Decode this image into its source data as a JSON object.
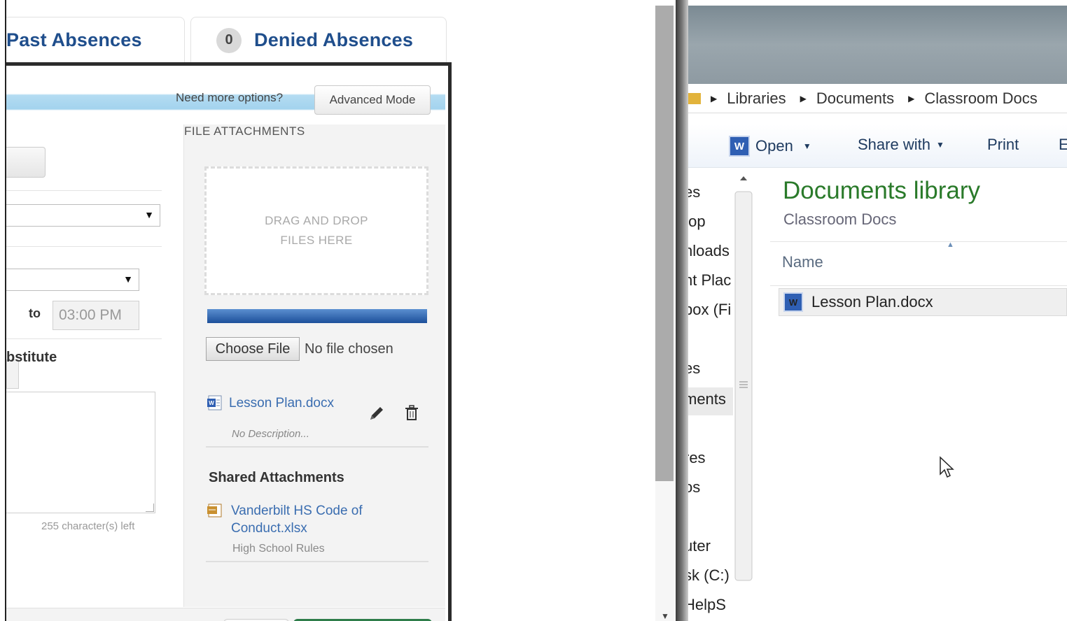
{
  "tabs": {
    "past": "Past Absences",
    "denied": "Denied Absences",
    "denied_count": "0"
  },
  "dialog": {
    "need_more": "Need more options?",
    "advanced_mode": "Advanced Mode",
    "to_label": "to",
    "end_time": "03:00 PM",
    "substitute_label": "bstitute",
    "chars_left": "255 character(s) left",
    "attachments_title": "FILE ATTACHMENTS",
    "dropzone_line1": "DRAG AND DROP",
    "dropzone_line2": "FILES HERE",
    "choose_file": "Choose File",
    "no_file": "No file chosen",
    "attachment": {
      "name": "Lesson Plan.docx",
      "description": "No Description..."
    },
    "shared_title": "Shared Attachments",
    "shared": {
      "name_line1": "Vanderbilt HS Code of",
      "name_line2": "Conduct.xlsx",
      "description": "High School Rules"
    }
  },
  "explorer": {
    "breadcrumb": [
      "Libraries",
      "Documents",
      "Classroom Docs"
    ],
    "commands": {
      "open": "Open",
      "share_with": "Share with",
      "print": "Print",
      "extra": "E"
    },
    "nav_items": [
      "es",
      "top",
      "nloads",
      "nt Plac",
      "box (Fi",
      "es",
      "ments",
      ":",
      "res",
      "os",
      "uter",
      "sk (C:)",
      "HelpS"
    ],
    "library_title": "Documents library",
    "library_sub": "Classroom Docs",
    "column_name": "Name",
    "files": [
      "Lesson Plan.docx"
    ]
  },
  "colors": {
    "tab_blue": "#1f4e8c",
    "library_green": "#2a7a2a",
    "progress_blue": "#1c4f9a",
    "confirm_green": "#2e7d4a"
  }
}
